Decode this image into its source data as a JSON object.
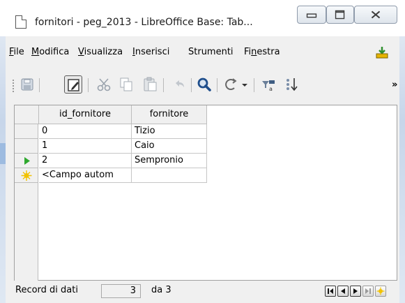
{
  "window": {
    "title": "fornitori - peg_2013 - LibreOffice Base: Tab..."
  },
  "menubar": {
    "items": [
      {
        "prefix": "",
        "accel": "F",
        "rest": "ile"
      },
      {
        "prefix": "",
        "accel": "M",
        "rest": "odifica"
      },
      {
        "prefix": "",
        "accel": "V",
        "rest": "isualizza"
      },
      {
        "prefix": "",
        "accel": "I",
        "rest": "nserisci"
      },
      {
        "prefix": "",
        "accel": "",
        "rest": "Strumenti"
      },
      {
        "prefix": "Fi",
        "accel": "n",
        "rest": "estra"
      }
    ]
  },
  "toolbar": {
    "icons": [
      "save-icon",
      "edit-mode-icon",
      "cut-icon",
      "copy-icon",
      "paste-icon",
      "undo-icon",
      "find-icon",
      "sort-icon",
      "autofilter-icon",
      "sort-ascending-icon"
    ],
    "overflow": "»"
  },
  "table": {
    "columns": [
      "id_fornitore",
      "fornitore"
    ],
    "rows": [
      {
        "id": "0",
        "name": "Tizio"
      },
      {
        "id": "1",
        "name": "Caio"
      },
      {
        "id": "2",
        "name": "Sempronio"
      }
    ],
    "new_row_placeholder": "<Campo autom",
    "current_row_index": 2
  },
  "statusbar": {
    "label": "Record di dati",
    "record": "3",
    "of_label": "da 3"
  },
  "colors": {
    "current_row_marker": "#2ea82e",
    "new_row_marker": "#f2c200"
  }
}
